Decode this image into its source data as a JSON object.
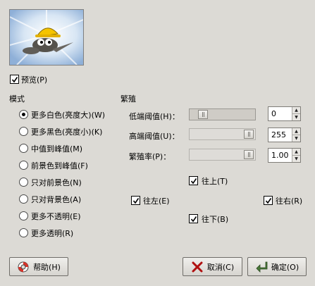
{
  "preview": {
    "label": "预览(P)",
    "checked": true
  },
  "mode": {
    "title": "模式",
    "options": [
      {
        "label": "更多白色(亮度大)(W)",
        "selected": true
      },
      {
        "label": "更多黑色(亮度小)(K)",
        "selected": false
      },
      {
        "label": "中值到峰值(M)",
        "selected": false
      },
      {
        "label": "前景色到峰值(F)",
        "selected": false
      },
      {
        "label": "只对前景色(N)",
        "selected": false
      },
      {
        "label": "只对背景色(A)",
        "selected": false
      },
      {
        "label": "更多不透明(E)",
        "selected": false
      },
      {
        "label": "更多透明(R)",
        "selected": false
      }
    ]
  },
  "propagate": {
    "title": "繁殖",
    "lower_threshold": {
      "label": "低端阈值(H)：",
      "value": "0",
      "level": 0.0
    },
    "upper_threshold": {
      "label": "高端阈值(U)：",
      "value": "255",
      "level": 1.0
    },
    "rate": {
      "label": "繁殖率(P)：",
      "value": "1.00",
      "level": 1.0
    },
    "directions": {
      "up": {
        "label": "往上(T)",
        "checked": true
      },
      "left": {
        "label": "往左(E)",
        "checked": true
      },
      "right": {
        "label": "往右(R)",
        "checked": true
      },
      "down": {
        "label": "往下(B)",
        "checked": true
      }
    }
  },
  "buttons": {
    "help": "帮助(H)",
    "cancel": "取消(C)",
    "ok": "确定(O)"
  },
  "colors": {
    "background": "#dcdad5",
    "cancel_icon": "#b01010",
    "ok_icon": "#4a7a3a"
  },
  "icons": {
    "help": "lifebuoy-icon",
    "cancel": "x-icon",
    "ok": "return-arrow-icon"
  }
}
